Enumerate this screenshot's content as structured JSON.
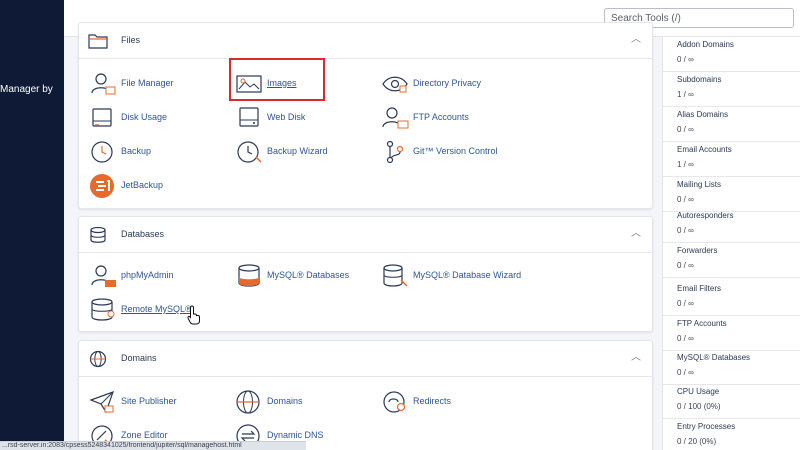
{
  "sidebar": {
    "brand_text": "Manager by"
  },
  "search": {
    "placeholder": "Search Tools (/)"
  },
  "panels": [
    {
      "title": "Files",
      "icon": "folder-icon",
      "items": [
        {
          "label": "File Manager",
          "icon": "file-manager-icon"
        },
        {
          "label": "Images",
          "icon": "images-icon"
        },
        {
          "label": "Directory Privacy",
          "icon": "directory-privacy-icon"
        },
        {
          "label": "Disk Usage",
          "icon": "disk-usage-icon"
        },
        {
          "label": "Web Disk",
          "icon": "web-disk-icon"
        },
        {
          "label": "FTP Accounts",
          "icon": "ftp-accounts-icon"
        },
        {
          "label": "Backup",
          "icon": "backup-icon"
        },
        {
          "label": "Backup Wizard",
          "icon": "backup-wizard-icon"
        },
        {
          "label": "Git™ Version Control",
          "icon": "git-icon"
        },
        {
          "label": "JetBackup",
          "icon": "jetbackup-icon"
        }
      ]
    },
    {
      "title": "Databases",
      "icon": "database-icon",
      "items": [
        {
          "label": "phpMyAdmin",
          "icon": "phpmyadmin-icon"
        },
        {
          "label": "MySQL® Databases",
          "icon": "mysql-databases-icon"
        },
        {
          "label": "MySQL® Database Wizard",
          "icon": "mysql-wizard-icon"
        },
        {
          "label": "Remote MySQL®",
          "icon": "remote-mysql-icon"
        }
      ]
    },
    {
      "title": "Domains",
      "icon": "globe-icon",
      "items": [
        {
          "label": "Site Publisher",
          "icon": "site-publisher-icon"
        },
        {
          "label": "Domains",
          "icon": "domains-icon"
        },
        {
          "label": "Redirects",
          "icon": "redirects-icon"
        },
        {
          "label": "Zone Editor",
          "icon": "zone-editor-icon"
        },
        {
          "label": "Dynamic DNS",
          "icon": "dynamic-dns-icon"
        }
      ]
    }
  ],
  "stats": [
    {
      "label": "Addon Domains",
      "value": "0 / ∞"
    },
    {
      "label": "Subdomains",
      "value": "1 / ∞"
    },
    {
      "label": "Alias Domains",
      "value": "0 / ∞"
    },
    {
      "label": "Email Accounts",
      "value": "1 / ∞"
    },
    {
      "label": "Mailing Lists",
      "value": "0 / ∞"
    },
    {
      "label": "Autoresponders",
      "value": "0 / ∞"
    },
    {
      "label": "Forwarders",
      "value": "0 / ∞"
    },
    {
      "label": "Email Filters",
      "value": "0 / ∞"
    },
    {
      "label": "FTP Accounts",
      "value": "0 / ∞"
    },
    {
      "label": "MySQL® Databases",
      "value": "0 / ∞"
    },
    {
      "label": "CPU Usage",
      "value": "0 / 100   (0%)"
    },
    {
      "label": "Entry Processes",
      "value": "0 / 20   (0%)"
    }
  ],
  "statusbar": {
    "url": "...rsd-server.in:2083/cpsess5248341025/frontend/jupiter/sql/managehost.html"
  },
  "colors": {
    "sidebar": "#0e1a36",
    "link": "#2e5597",
    "accent": "#e8692c",
    "highlight": "#d82c2c"
  }
}
